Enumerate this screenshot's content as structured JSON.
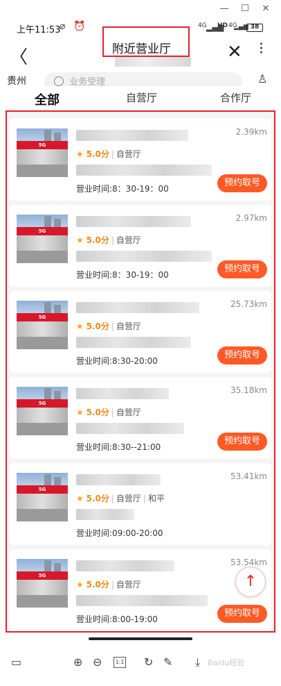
{
  "window": {
    "minimize_icon": "minimize-icon",
    "maximize_icon": "maximize-icon",
    "close_icon": "close-icon"
  },
  "status_bar": {
    "time": "上午11:53",
    "network_a": "4G",
    "network_b": "4G",
    "hd": "HD",
    "battery": "38"
  },
  "header": {
    "title": "附近营业厅"
  },
  "search": {
    "city": "贵州",
    "placeholder": "业务受理"
  },
  "tabs": [
    {
      "label": "全部",
      "active": true
    },
    {
      "label": "自营厅",
      "active": false
    },
    {
      "label": "合作厅",
      "active": false
    }
  ],
  "shops": [
    {
      "distance": "2.39km",
      "score": "5.0分",
      "type": "自营厅",
      "extra": "",
      "hours": "营业时间:8：30-19：00",
      "button": "预约取号"
    },
    {
      "distance": "2.97km",
      "score": "5.0分",
      "type": "自营厅",
      "extra": "",
      "hours": "营业时间:8：30-19：00",
      "button": "预约取号"
    },
    {
      "distance": "25.73km",
      "score": "5.0分",
      "type": "自营厅",
      "extra": "",
      "hours": "营业时间:8:30-20:00",
      "button": "预约取号"
    },
    {
      "distance": "35.18km",
      "score": "5.0分",
      "type": "自营厅",
      "extra": "",
      "hours": "营业时间:8:30--21:00",
      "button": "预约取号"
    },
    {
      "distance": "53.41km",
      "score": "5.0分",
      "type": "自营厅",
      "extra": "和平",
      "hours": "营业时间:09:00-20:00",
      "button": ""
    },
    {
      "distance": "53.54km",
      "score": "5.0分",
      "type": "自营厅",
      "extra": "",
      "hours": "营业时间:8:00-19:00",
      "button": "预约取号"
    }
  ],
  "sign_text": "5G",
  "toolbar": {
    "zoom_label": "1:1"
  },
  "watermark": "Baidu经验",
  "colors": {
    "accent": "#ff5a26",
    "highlight_frame": "#e8202a",
    "star": "#f5a623"
  }
}
